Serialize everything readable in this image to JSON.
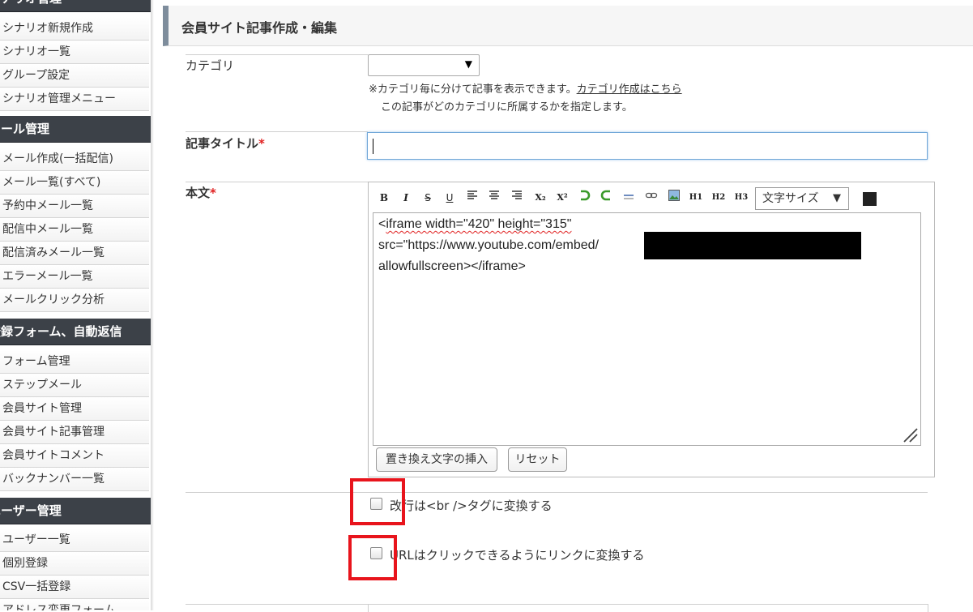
{
  "sidebar": {
    "sections": [
      {
        "title": "シナリオ管理",
        "items": [
          "シナリオ新規作成",
          "シナリオ一覧",
          "グループ設定",
          "シナリオ管理メニュー"
        ]
      },
      {
        "title": "メール管理",
        "items": [
          "メール作成(一括配信)",
          "メール一覧(すべて)",
          "予約中メール一覧",
          "配信中メール一覧",
          "配信済みメール一覧",
          "エラーメール一覧",
          "メールクリック分析"
        ]
      },
      {
        "title": "登録フォーム、自動返信",
        "items": [
          "フォーム管理",
          "ステップメール",
          "会員サイト管理",
          "会員サイト記事管理",
          "会員サイトコメント",
          "バックナンバー一覧"
        ]
      },
      {
        "title": "ユーザー管理",
        "items": [
          "ユーザー一覧",
          "個別登録",
          "CSV一括登録",
          "アドレス変更フォーム"
        ]
      }
    ]
  },
  "page": {
    "title": "会員サイト記事作成・編集"
  },
  "form": {
    "category": {
      "label": "カテゴリ",
      "selected": "",
      "note_prefix": "※カテゴリ毎に分けて記事を表示できます。",
      "note_link": "カテゴリ作成はこちら",
      "note_line2": "この記事がどのカテゴリに所属するかを指定します。"
    },
    "title": {
      "label": "記事タイトル",
      "required_mark": "*",
      "value": ""
    },
    "body": {
      "label": "本文",
      "required_mark": "*",
      "toolbar": [
        "B",
        "I",
        "S",
        "U",
        "align-left",
        "align-center",
        "align-right",
        "X₂",
        "X²",
        "undo",
        "redo",
        "hr",
        "link",
        "image",
        "H1",
        "H2",
        "H3"
      ],
      "font_size_label": "文字サイズ",
      "text_color": "#222222",
      "content": {
        "line1": "<iframe width=\"420\" height=\"315\"",
        "line2": "src=\"https://www.youtube.com/embed/",
        "line3": "allowfullscreen></iframe>"
      },
      "insert_button": "置き換え文字の挿入",
      "reset_button": "リセット"
    },
    "options": {
      "br_convert": {
        "label": "改行は<br />タグに変換する",
        "checked": false
      },
      "url_convert": {
        "label": "URLはクリックできるようにリンクに変換する",
        "checked": false
      }
    }
  },
  "colors": {
    "highlight": "#e8141c",
    "sidebar_header": "#3c4148",
    "accent_bar": "#7e8d9c"
  }
}
